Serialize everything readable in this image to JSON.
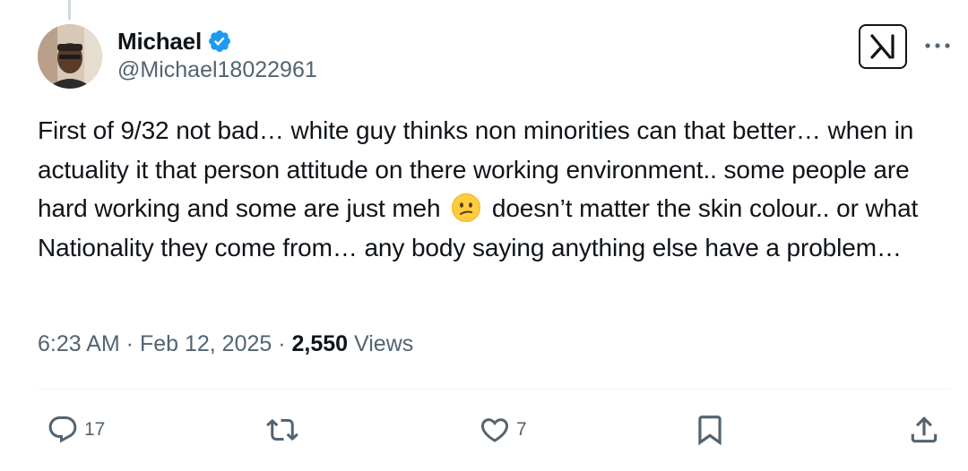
{
  "author": {
    "display_name": "Michael",
    "handle": "@Michael18022961",
    "verified": true
  },
  "tweet": {
    "text_part1": "First of 9/32 not bad… white guy thinks non minorities can that better… when in actuality it that person attitude on there working environment.. some people are hard working and some are just meh",
    "emoji": "confused-face",
    "text_part2": "doesn’t matter the skin colour.. or what Nationality they come from… any body saying anything else have a problem…"
  },
  "meta": {
    "time": "6:23 AM",
    "separator1": " · ",
    "date": "Feb 12, 2025",
    "separator2": " · ",
    "views_count": "2,550",
    "views_label": " Views"
  },
  "actions": {
    "reply_count": "17",
    "repost_count": "",
    "like_count": "7"
  },
  "colors": {
    "text_primary": "#0f1419",
    "text_secondary": "#536471",
    "verified_blue": "#1d9bf0",
    "divider": "#eff3f4"
  },
  "icons": [
    "verified-badge-icon",
    "grok-icon",
    "more-icon",
    "reply-icon",
    "repost-icon",
    "like-icon",
    "bookmark-icon",
    "share-icon"
  ]
}
